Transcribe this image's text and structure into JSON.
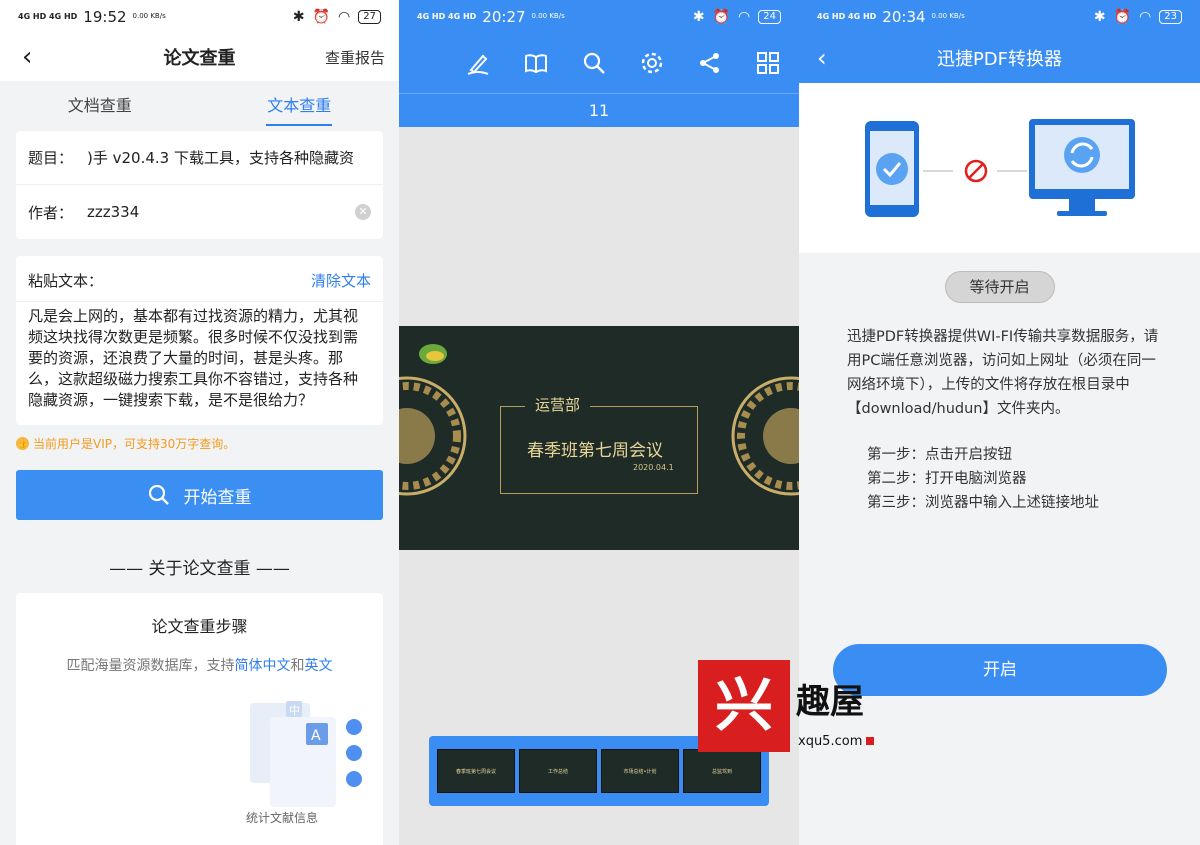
{
  "panel1": {
    "status": {
      "signal": "4G HD 4G HD",
      "time": "19:52",
      "speed": "0.00 KB/s",
      "battery": "27"
    },
    "header": {
      "title": "论文查重",
      "report": "查重报告"
    },
    "tabs": [
      {
        "label": "文档查重"
      },
      {
        "label": "文本查重"
      }
    ],
    "form": {
      "title_label": "题目：",
      "title_value": ")手 v20.4.3 下载工具，支持各种隐藏资",
      "author_label": "作者：",
      "author_value": "zzz334"
    },
    "paste": {
      "label": "粘贴文本：",
      "clear": "清除文本",
      "text": "凡是会上网的，基本都有过找资源的精力，尤其视频这块找得次数更是频繁。很多时候不仅没找到需要的资源，还浪费了大量的时间，甚是头疼。那么，这款超级磁力搜索工具你不容错过，支持各种隐藏资源，一键搜索下载，是不是很给力？"
    },
    "vip_note": "当前用户是VIP，可支持30万字查询。",
    "start_button": "开始查重",
    "about_title": "—— 关于论文查重 ——",
    "steps_title": "论文查重步骤",
    "steps_desc_a": "匹配海量资源数据库，支持",
    "steps_desc_b": "简体中文",
    "steps_desc_c": "和",
    "steps_desc_d": "英文",
    "illus_char": "中",
    "illus_letter": "A",
    "illus_caption": "统计文献信息"
  },
  "panel2": {
    "status": {
      "signal": "4G HD 4G HD",
      "time": "20:27",
      "speed": "0.00 KB/s",
      "battery": "24"
    },
    "toolbar_icons": [
      "pen-icon",
      "book-icon",
      "search-icon",
      "gear-icon",
      "share-icon",
      "grid-icon"
    ],
    "page_number": "11",
    "slide": {
      "dept": "运营部",
      "title": "春季班第七周会议",
      "date": "2020.04.1"
    },
    "thumbnails": [
      {
        "label": "春季班第七周会议"
      },
      {
        "label": "工作总结"
      },
      {
        "label": "市场总结•计划"
      },
      {
        "label": "总监驾到"
      }
    ]
  },
  "panel3": {
    "status": {
      "signal": "4G HD 4G HD",
      "time": "20:34",
      "speed": "0.00 KB/s",
      "battery": "23"
    },
    "header": {
      "title": "迅捷PDF转换器"
    },
    "wait_button": "等待开启",
    "description": "迅捷PDF转换器提供WI-FI传输共享数据服务，请用PC端任意浏览器，访问如上网址（必须在同一网络环境下），上传的文件将存放在根目录中【download/hudun】文件夹内。",
    "steps": [
      "第一步：点击开启按钮",
      "第二步：打开电脑浏览器",
      "第三步：浏览器中输入上述链接地址"
    ],
    "open_button": "开启"
  },
  "watermark": {
    "glyph": "兴",
    "name": "趣屋",
    "domain": "xqu5.com"
  },
  "colors": {
    "accent": "#3a8ef3",
    "vip": "#f39b1e",
    "slide_bg": "#1e2b27",
    "gold": "#e9d79a",
    "brand_red": "#d81e1e"
  }
}
